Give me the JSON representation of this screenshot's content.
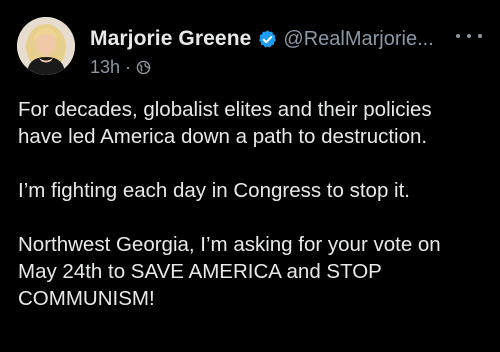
{
  "post": {
    "author": {
      "display_name": "Marjorie Greene",
      "handle": "@RealMarjorie...",
      "verified": true
    },
    "timestamp": "13h",
    "separator": "·",
    "visibility_icon": "globe-icon",
    "menu_icon": "more-options-icon",
    "body": {
      "paragraph_1_line_1": "For decades, globalist elites and their policies",
      "paragraph_1_line_2": "have led America down a path to destruction.",
      "paragraph_2_line_1": "I’m fighting each day in Congress to stop it.",
      "paragraph_3_line_1": "Northwest Georgia, I’m asking for your vote on",
      "paragraph_3_line_2": "May 24th to SAVE AMERICA and STOP",
      "paragraph_3_line_3": "COMMUNISM!"
    }
  },
  "colors": {
    "background": "#000000",
    "primary_text": "#e7e9ea",
    "secondary_text": "#8b98a5",
    "verified_badge": "#1d9bf0"
  }
}
